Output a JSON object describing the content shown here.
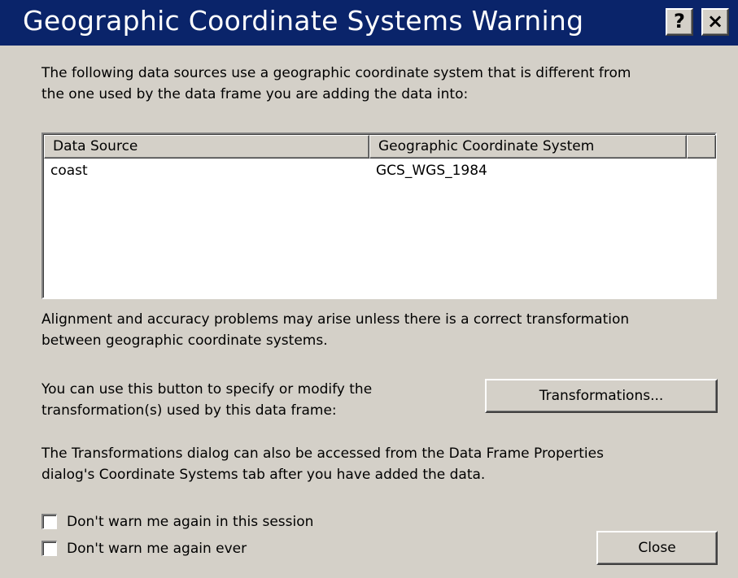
{
  "window": {
    "title": "Geographic Coordinate Systems Warning",
    "help_label": "?",
    "close_label": "×"
  },
  "intro": {
    "line1": "The following data sources use a geographic coordinate system that is different from",
    "line2": "the one used by the data frame you are adding the data into:"
  },
  "table": {
    "headers": [
      "Data Source",
      "Geographic Coordinate System",
      ""
    ],
    "rows": [
      [
        "coast",
        "GCS_WGS_1984"
      ]
    ]
  },
  "alignment": {
    "line1": "Alignment and accuracy problems may arise unless there is a correct transformation",
    "line2": "between geographic coordinate systems."
  },
  "transform": {
    "line1": "You can use this button to specify or modify the",
    "line2": "transformation(s) used by this data frame:",
    "button_label": "Transformations..."
  },
  "access_note": {
    "line1": "The Transformations dialog can also be accessed from the Data Frame Properties",
    "line2": "dialog's Coordinate Systems tab after you have added the data."
  },
  "options": {
    "session_label": "Don't warn me again in this session",
    "session_checked": false,
    "ever_label": "Don't warn me again ever",
    "ever_checked": false
  },
  "close_button_label": "Close",
  "colors": {
    "titlebar": "#0a246a",
    "dialog_face": "#d4d0c8",
    "list_background": "#ffffff"
  }
}
